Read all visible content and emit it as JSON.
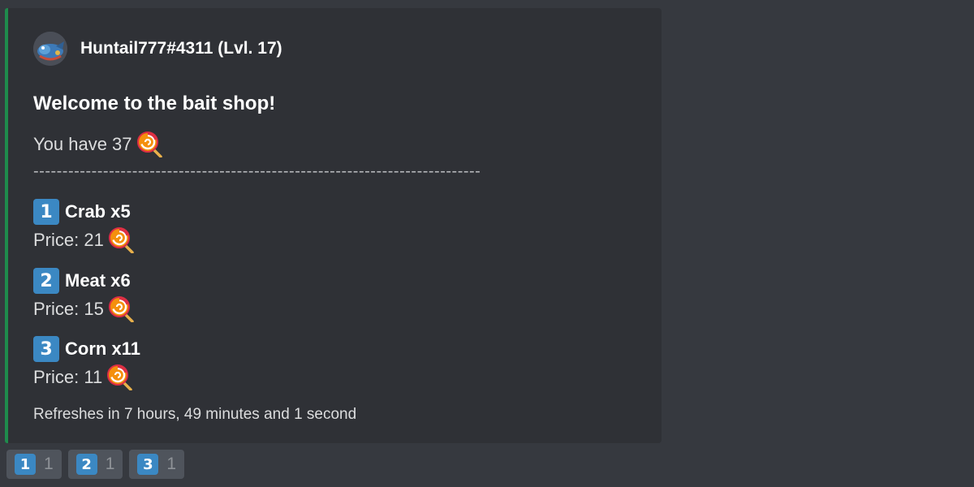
{
  "embed": {
    "accent_color": "#1f8b4c",
    "author": {
      "name": "Huntail777#4311 (Lvl. 17)"
    },
    "title": "Welcome to the bait shop!",
    "balance_text": "You have 37",
    "currency_icon": "lollipop-icon",
    "divider": "-----------------------------------------------------------------------------",
    "items": [
      {
        "key": "1",
        "name": "Crab x5",
        "price_text": "Price: 21"
      },
      {
        "key": "2",
        "name": "Meat x6",
        "price_text": "Price: 15"
      },
      {
        "key": "3",
        "name": "Corn x11",
        "price_text": "Price: 11"
      }
    ],
    "footer": "Refreshes in 7 hours, 49 minutes and 1 second"
  },
  "buttons": [
    {
      "key": "1",
      "count": "1"
    },
    {
      "key": "2",
      "count": "1"
    },
    {
      "key": "3",
      "count": "1"
    }
  ]
}
